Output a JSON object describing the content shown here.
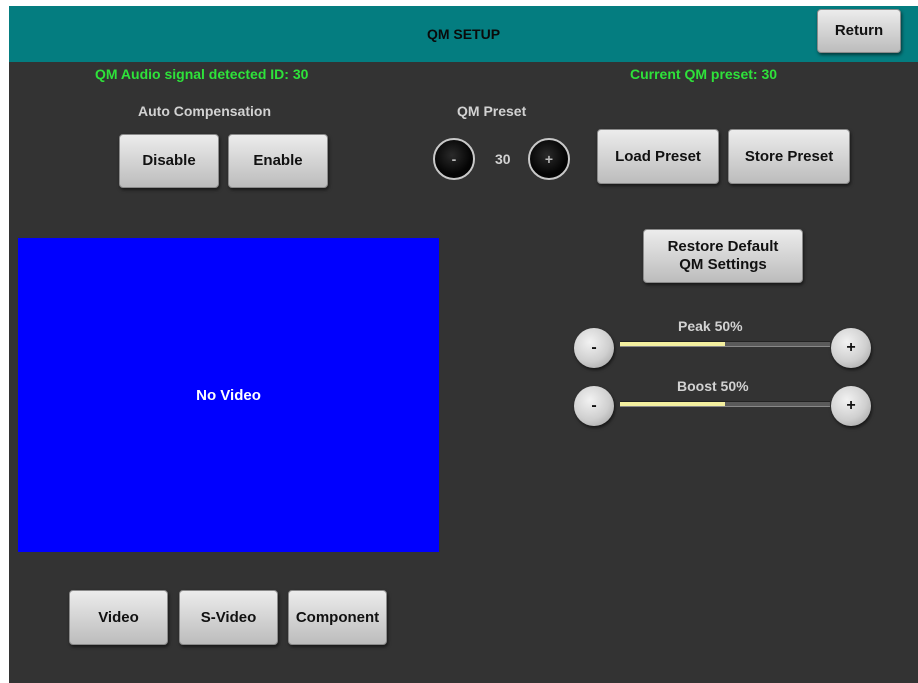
{
  "header": {
    "title": "QM SETUP",
    "return_label": "Return"
  },
  "status": {
    "audio_signal_label": "QM Audio signal detected ID:",
    "audio_signal_id": "30",
    "current_preset_label": "Current QM preset:",
    "current_preset_value": "30"
  },
  "auto_compensation": {
    "title": "Auto Compensation",
    "disable_label": "Disable",
    "enable_label": "Enable"
  },
  "qm_preset": {
    "title": "QM Preset",
    "value": "30",
    "minus_label": "-",
    "plus_label": "+",
    "load_label": "Load Preset",
    "store_label": "Store Preset"
  },
  "restore_default": {
    "line1": "Restore Default",
    "line2": "QM Settings"
  },
  "sliders": {
    "peak": {
      "label": "Peak 50%",
      "value_percent": 50,
      "minus_label": "-",
      "plus_label": "+"
    },
    "boost": {
      "label": "Boost 50%",
      "value_percent": 50,
      "minus_label": "-",
      "plus_label": "+"
    }
  },
  "video": {
    "status_text": "No Video",
    "background_color": "#0000ff"
  },
  "inputs": {
    "video_label": "Video",
    "svideo_label": "S-Video",
    "component_label": "Component"
  },
  "colors": {
    "header": "#047d80",
    "panel": "#333333",
    "status_green": "#2ee23a",
    "slider_fill": "#f4f0a0"
  }
}
